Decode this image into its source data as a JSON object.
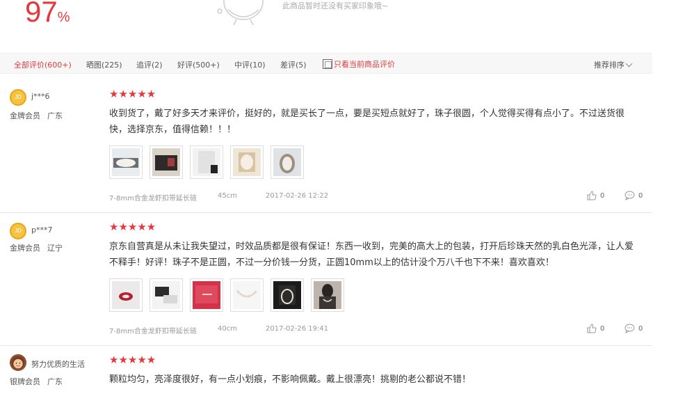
{
  "summary": {
    "rate_number": "97",
    "rate_unit": "%",
    "no_impression_text": "此商品暂时还没有买家印象哦~"
  },
  "filters": {
    "tabs": [
      "全部评价(600+)",
      "晒图(225)",
      "追评(2)",
      "好评(500+)",
      "中评(10)",
      "差评(5)"
    ],
    "only_current_label": "只看当前商品评价",
    "sort_label": "推荐排序"
  },
  "reviews": [
    {
      "username": "j***6",
      "avatar_text": "JD",
      "level": "金牌会员",
      "location": "广东",
      "stars": "★★★★★",
      "content": "收到货了，戴了好多天才来评价，挺好的，就是买长了一点，要是买短点就好了，珠子很圆，个人觉得买得有点小了。不过送货很快，选择京东，值得信赖！！！",
      "spec": "7-8mm合金龙虾扣带延长链",
      "length": "45cm",
      "date": "2017-02-26 12:22",
      "likes": "0",
      "comments": "0"
    },
    {
      "username": "p***7",
      "avatar_text": "JD",
      "level": "金牌会员",
      "location": "辽宁",
      "stars": "★★★★★",
      "content": "京东自营真是从未让我失望过，时效品质都是很有保证！东西一收到，完美的高大上的包装，打开后珍珠天然的乳白色光泽，让人爱不释手！好评！珠子不是正圆，不过一分价钱一分货，正圆10mm以上的估计没个万八千也下不来！喜欢喜欢！",
      "spec": "7-8mm合金龙虾扣带延长链",
      "length": "40cm",
      "date": "2017-02-26 19:41",
      "likes": "0",
      "comments": "0"
    },
    {
      "username": "努力优质的生活",
      "level": "银牌会员",
      "location": "广东",
      "stars": "★★★★★",
      "content": "颗粒均匀，亮泽度很好，有一点小划痕，不影响佩戴。戴上很漂亮！挑剔的老公都说不错！"
    }
  ],
  "colors": {
    "accent": "#e4393c",
    "text": "#333333",
    "muted": "#999999"
  }
}
